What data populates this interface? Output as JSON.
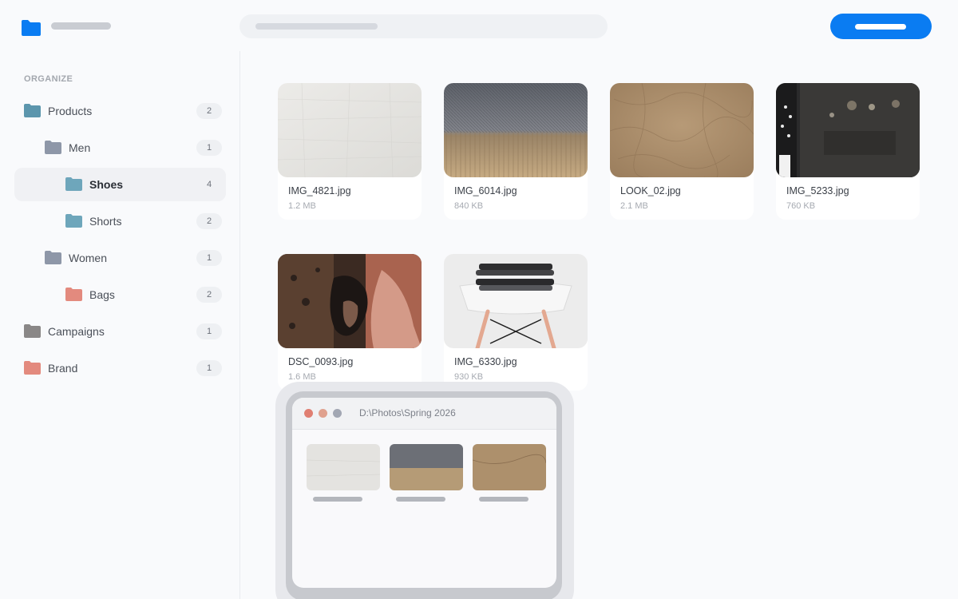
{
  "app": {
    "logo_icon": "folder-icon",
    "accent_color": "#0a7cf2"
  },
  "sidebar": {
    "section_title": "ORGANIZE",
    "items": [
      {
        "label": "Products",
        "count": "2",
        "level": 0,
        "folder_color": "#5c96ad",
        "active": false
      },
      {
        "label": "Men",
        "count": "1",
        "level": 1,
        "folder_color": "#8e97a8",
        "active": false
      },
      {
        "label": "Shoes",
        "count": "4",
        "level": 2,
        "folder_color": "#6ea6bb",
        "active": true
      },
      {
        "label": "Shorts",
        "count": "2",
        "level": 2,
        "folder_color": "#6ea6bb",
        "active": false
      },
      {
        "label": "Women",
        "count": "1",
        "level": 1,
        "folder_color": "#8e97a8",
        "active": false
      },
      {
        "label": "Bags",
        "count": "2",
        "level": 2,
        "folder_color": "#e38a7e",
        "active": false
      },
      {
        "label": "Campaigns",
        "count": "1",
        "level": 0,
        "folder_color": "#8a8787",
        "active": false
      },
      {
        "label": "Brand",
        "count": "1",
        "level": 0,
        "folder_color": "#e38a7e",
        "active": false
      }
    ]
  },
  "files": [
    {
      "name": "IMG_4821.jpg",
      "size": "1.2 MB",
      "thumbnail": "white-linen-texture"
    },
    {
      "name": "IMG_6014.jpg",
      "size": "840 KB",
      "thumbnail": "grey-tan-fabric-texture"
    },
    {
      "name": "LOOK_02.jpg",
      "size": "2.1 MB",
      "thumbnail": "brown-burlap-texture"
    },
    {
      "name": "IMG_5233.jpg",
      "size": "760 KB",
      "thumbnail": "dark-store-clothing-rack"
    },
    {
      "name": "DSC_0093.jpg",
      "size": "1.6 MB",
      "thumbnail": "dark-tattooed-hands"
    },
    {
      "name": "IMG_6330.jpg",
      "size": "930 KB",
      "thumbnail": "folded-clothes-on-chair"
    }
  ],
  "drag_window": {
    "path": "D:\\Photos\\Spring 2026",
    "dot_colors": [
      "#e07f72",
      "#e0a18e",
      "#a2a7b3"
    ],
    "thumbnails": [
      "white-linen-texture",
      "grey-tan-fabric-texture",
      "brown-burlap-texture"
    ]
  }
}
